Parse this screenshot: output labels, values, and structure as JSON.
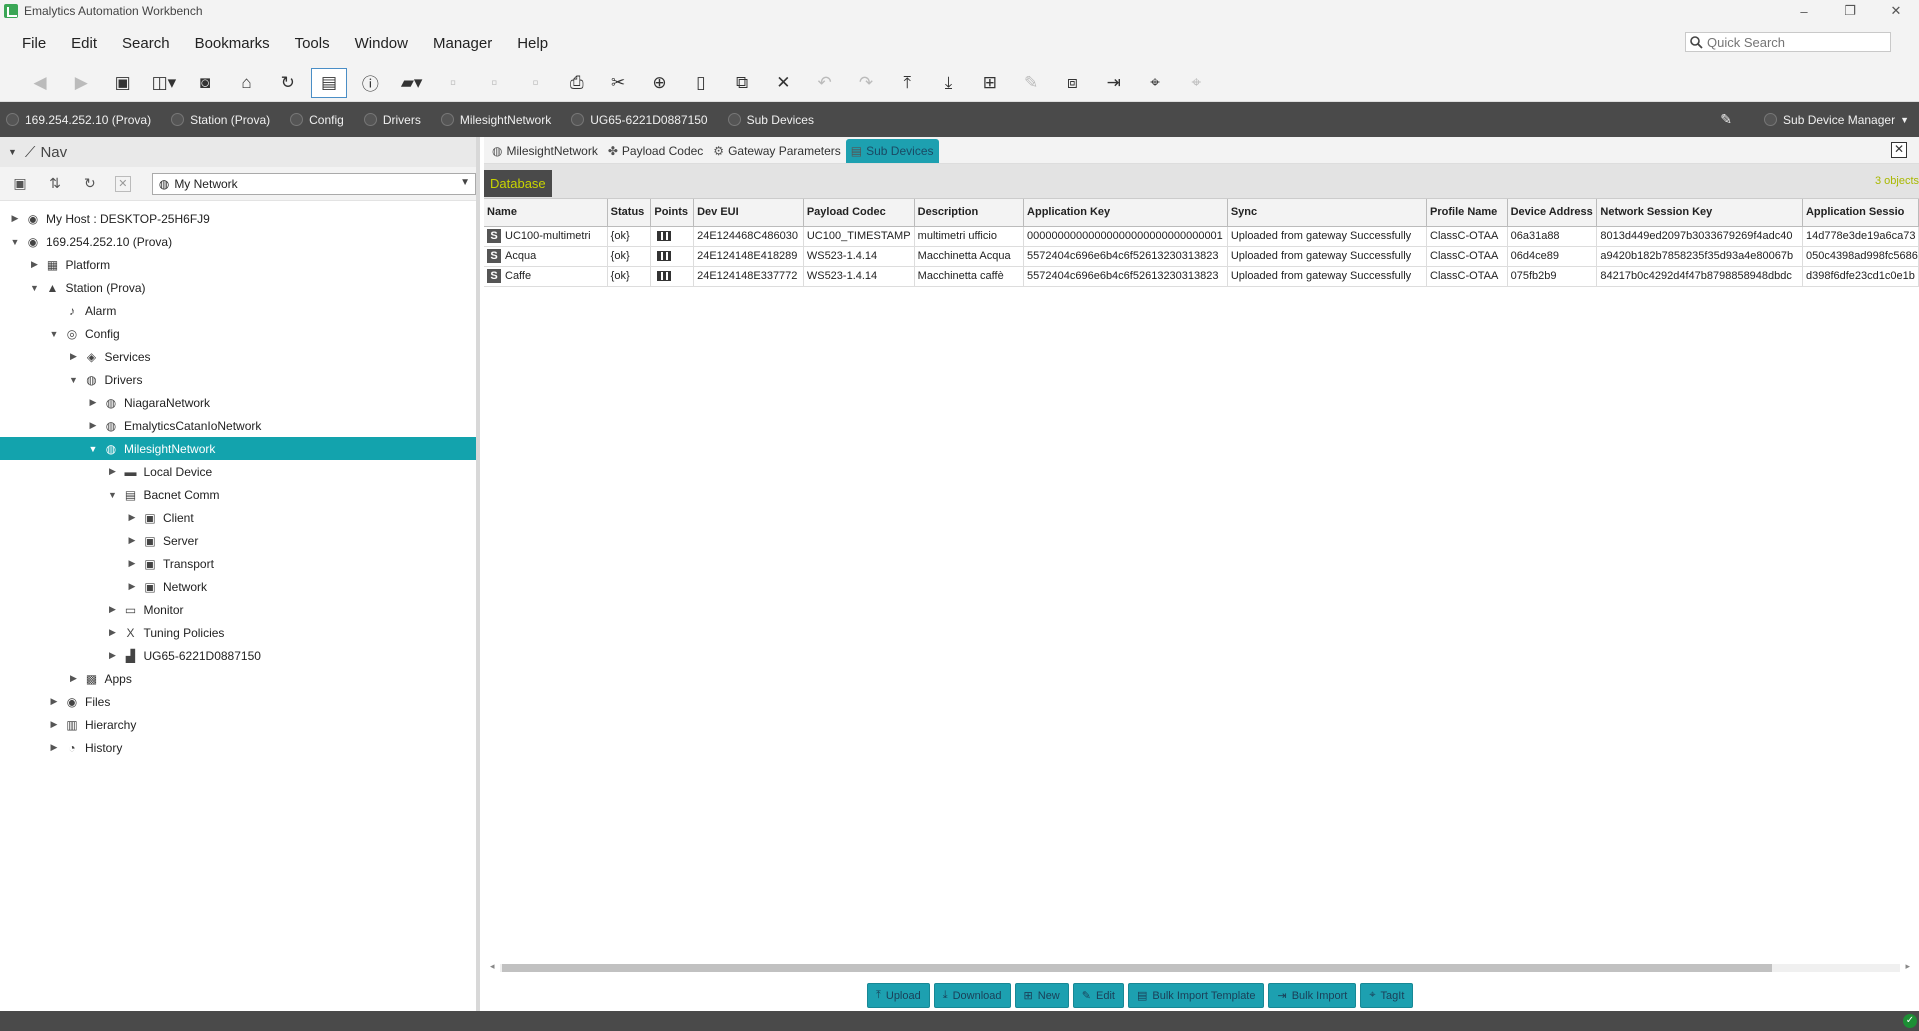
{
  "window": {
    "title": "Emalytics Automation Workbench",
    "controls": [
      "–",
      "❐",
      "✕"
    ]
  },
  "menu": [
    "File",
    "Edit",
    "Search",
    "Bookmarks",
    "Tools",
    "Window",
    "Manager",
    "Help"
  ],
  "quick_search": {
    "placeholder": "Quick Search"
  },
  "locator": {
    "crumbs": [
      "169.254.252.10 (Prova)",
      "Station (Prova)",
      "Config",
      "Drivers",
      "MilesightNetwork",
      "UG65-6221D0887150",
      "Sub Devices"
    ],
    "view": "Sub Device Manager"
  },
  "nav": {
    "title": "Nav",
    "selector": "My Network",
    "tree": [
      {
        "label": "My Host : DESKTOP-25H6FJ9",
        "depth": 0,
        "expanded": false,
        "icon": "host-icon"
      },
      {
        "label": "169.254.252.10 (Prova)",
        "depth": 0,
        "expanded": true,
        "icon": "station-connection-icon"
      },
      {
        "label": "Platform",
        "depth": 1,
        "expanded": false,
        "icon": "platform-icon"
      },
      {
        "label": "Station (Prova)",
        "depth": 1,
        "expanded": true,
        "icon": "station-icon"
      },
      {
        "label": "Alarm",
        "depth": 2,
        "leaf": true,
        "icon": "bell-icon"
      },
      {
        "label": "Config",
        "depth": 2,
        "expanded": true,
        "icon": "config-icon"
      },
      {
        "label": "Services",
        "depth": 3,
        "expanded": false,
        "icon": "services-icon"
      },
      {
        "label": "Drivers",
        "depth": 3,
        "expanded": true,
        "icon": "drivers-icon"
      },
      {
        "label": "NiagaraNetwork",
        "depth": 4,
        "expanded": false,
        "icon": "network-icon"
      },
      {
        "label": "EmalyticsCatanIoNetwork",
        "depth": 4,
        "expanded": false,
        "icon": "network-icon"
      },
      {
        "label": "MilesightNetwork",
        "depth": 4,
        "expanded": true,
        "selected": true,
        "icon": "network-icon"
      },
      {
        "label": "Local Device",
        "depth": 5,
        "expanded": false,
        "icon": "device-icon"
      },
      {
        "label": "Bacnet Comm",
        "depth": 5,
        "expanded": true,
        "icon": "comm-icon"
      },
      {
        "label": "Client",
        "depth": 6,
        "expanded": false,
        "icon": "folder-icon"
      },
      {
        "label": "Server",
        "depth": 6,
        "expanded": false,
        "icon": "folder-icon"
      },
      {
        "label": "Transport",
        "depth": 6,
        "expanded": false,
        "icon": "folder-icon"
      },
      {
        "label": "Network",
        "depth": 6,
        "expanded": false,
        "icon": "folder-icon"
      },
      {
        "label": "Monitor",
        "depth": 5,
        "expanded": false,
        "icon": "monitor-icon"
      },
      {
        "label": "Tuning Policies",
        "depth": 5,
        "expanded": false,
        "icon": "tuning-icon"
      },
      {
        "label": "UG65-6221D0887150",
        "depth": 5,
        "expanded": false,
        "icon": "gateway-icon"
      },
      {
        "label": "Apps",
        "depth": 3,
        "expanded": false,
        "icon": "apps-icon"
      },
      {
        "label": "Files",
        "depth": 2,
        "expanded": false,
        "icon": "files-icon"
      },
      {
        "label": "Hierarchy",
        "depth": 2,
        "expanded": false,
        "icon": "hierarchy-icon"
      },
      {
        "label": "History",
        "depth": 2,
        "expanded": false,
        "icon": "history-icon"
      }
    ]
  },
  "tabs": [
    {
      "label": "MilesightNetwork",
      "icon": "network-icon",
      "active": false
    },
    {
      "label": "Payload Codec",
      "icon": "puzzle-icon",
      "active": false
    },
    {
      "label": "Gateway Parameters",
      "icon": "gear-icon",
      "active": false
    },
    {
      "label": "Sub Devices",
      "icon": "subdevices-icon",
      "active": true
    }
  ],
  "database": {
    "tab_label": "Database",
    "count": "3 objects",
    "columns": [
      "Name",
      "Status",
      "Points",
      "Dev EUI",
      "Payload Codec",
      "Description",
      "Application Key",
      "Sync",
      "Profile Name",
      "Device Address",
      "Network Session Key",
      "Application Sessio"
    ],
    "rows": [
      [
        "UC100-multimetri",
        "{ok}",
        "",
        "24E124468C486030",
        "UC100_TIMESTAMP",
        "multimetri ufficio",
        "00000000000000000000000000000001",
        "Uploaded from gateway Successfully",
        "ClassC-OTAA",
        "06a31a88",
        "8013d449ed2097b3033679269f4adc40",
        "14d778e3de19a6ca73"
      ],
      [
        "Acqua",
        "{ok}",
        "",
        "24E124148E418289",
        "WS523-1.4.14",
        "Macchinetta Acqua",
        "5572404c696e6b4c6f52613230313823",
        "Uploaded from gateway Successfully",
        "ClassC-OTAA",
        "06d4ce89",
        "a9420b182b7858235f35d93a4e80067b",
        "050c4398ad998fc5686"
      ],
      [
        "Caffe",
        "{ok}",
        "",
        "24E124148E337772",
        "WS523-1.4.14",
        "Macchinetta caffè",
        "5572404c696e6b4c6f52613230313823",
        "Uploaded from gateway Successfully",
        "ClassC-OTAA",
        "075fb2b9",
        "84217b0c4292d4f47b8798858948dbdc",
        "d398f6dfe23cd1c0e1b"
      ]
    ]
  },
  "actions": [
    {
      "label": "Upload",
      "icon": "upload-icon"
    },
    {
      "label": "Download",
      "icon": "download-icon"
    },
    {
      "label": "New",
      "icon": "new-icon"
    },
    {
      "label": "Edit",
      "icon": "edit-icon"
    },
    {
      "label": "Bulk Import Template",
      "icon": "template-icon"
    },
    {
      "label": "Bulk Import",
      "icon": "import-icon"
    },
    {
      "label": "TagIt",
      "icon": "tag-icon"
    }
  ],
  "colors": {
    "accent": "#13a3ad",
    "locator_bg": "#4a4a4a",
    "database_label": "#c8d400"
  }
}
